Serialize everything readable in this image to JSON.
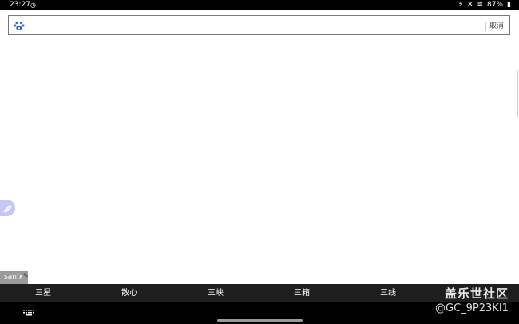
{
  "status_bar": {
    "time": "23:27",
    "battery": "87%"
  },
  "search": {
    "placeholder": "",
    "value": "",
    "cancel_label": "取消"
  },
  "ime": {
    "composition": "san'x",
    "candidates": [
      "三星",
      "散心",
      "三峡",
      "三箱",
      "三线"
    ]
  },
  "watermark": {
    "title": "盖乐世社区",
    "user_id": "@GC_9P23KI1"
  },
  "colors": {
    "candidate_bar": "#1e1e1e",
    "float_button": "#c7c7f7",
    "baidu_blue": "#2a62e0"
  }
}
